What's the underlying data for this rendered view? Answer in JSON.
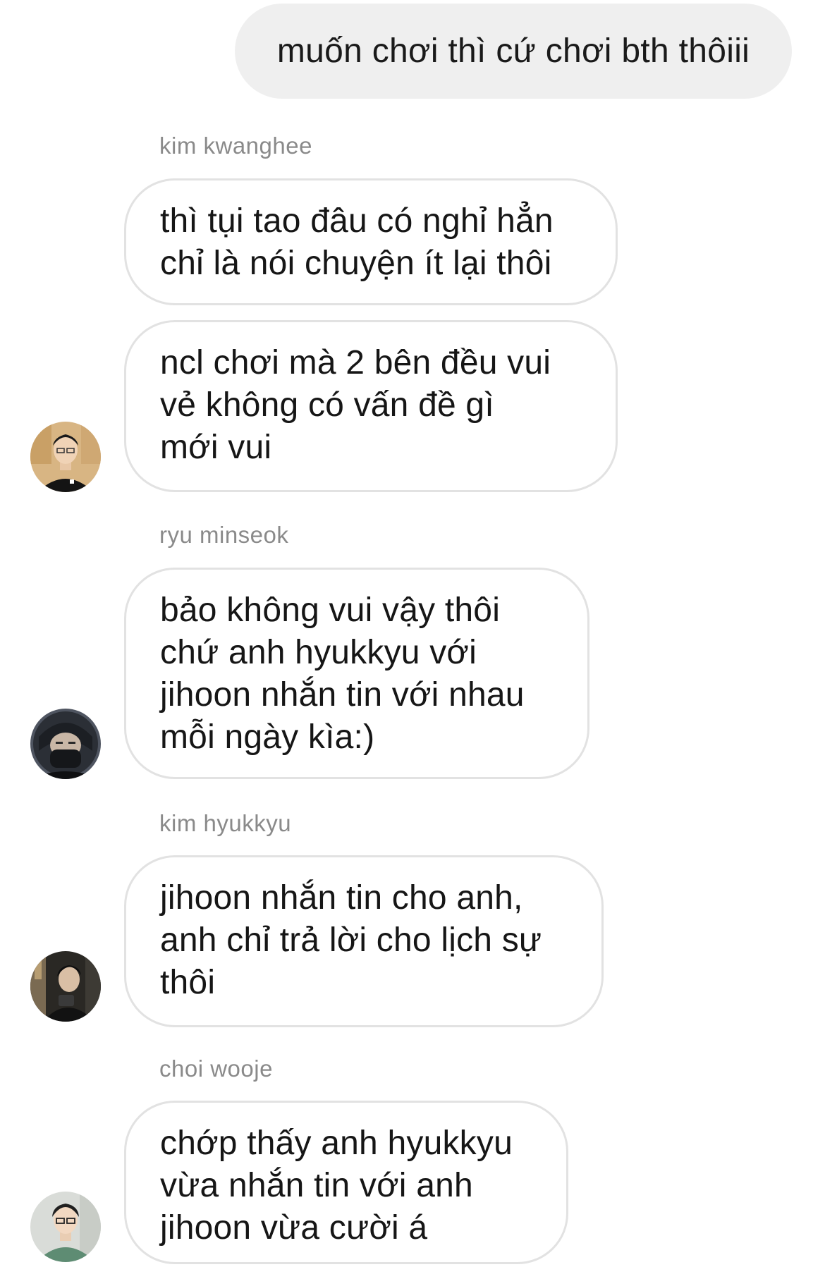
{
  "outgoing": {
    "text": "muốn chơi thì cứ chơi bth thôiii"
  },
  "groups": [
    {
      "sender": "kim kwanghee",
      "avatar": "person-avatar-light-bg",
      "messages": [
        "thì tụi tao đâu có nghỉ hẳn\nchỉ là nói chuyện ít lại thôi",
        "ncl chơi mà 2 bên đều vui\nvẻ không có vấn đề gì\nmới vui"
      ]
    },
    {
      "sender": "ryu minseok",
      "avatar": "person-avatar-dark-hood",
      "messages": [
        "bảo không vui vậy thôi\nchứ anh hyukkyu với\njihoon nhắn tin với nhau\nmỗi ngày kìa:)"
      ]
    },
    {
      "sender": "kim hyukkyu",
      "avatar": "person-avatar-dark-bg",
      "messages": [
        "jihoon nhắn tin cho anh,\nanh chỉ trả lời cho lịch sự\nthôi"
      ]
    },
    {
      "sender": "choi wooje",
      "avatar": "person-avatar-green-shirt",
      "messages": [
        "chớp thấy anh hyukkyu\nvừa nhắn tin với anh\njihoon vừa cười á"
      ]
    }
  ],
  "colors": {
    "outgoing_bubble": "#efefef",
    "incoming_border": "#e2e2e2",
    "sender_label": "#8a8a8a"
  }
}
